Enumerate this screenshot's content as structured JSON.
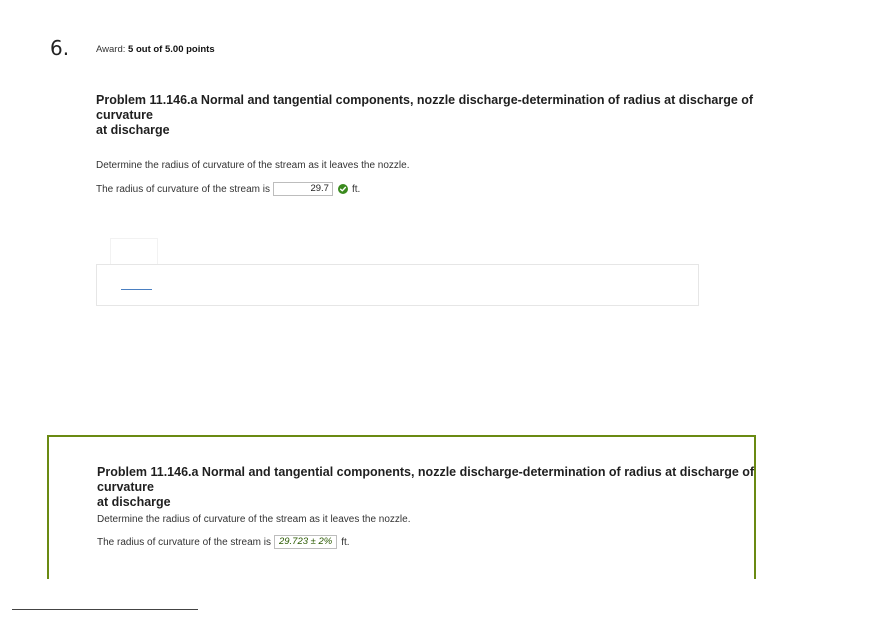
{
  "question": {
    "number": "6.",
    "award_label": "Award:",
    "award_value": "5 out of 5.00 points"
  },
  "problem": {
    "title_line1": "Problem 11.146.a Normal and tangential components, nozzle discharge-determination of radius at discharge of curvature",
    "title_line2": "at discharge",
    "prompt": "Determine the radius of curvature of the stream as it leaves the nozzle.",
    "answer_label": "The radius of curvature of the stream is",
    "answer_value": "29.7",
    "answer_unit": "ft."
  },
  "solution": {
    "title_line1": "Problem 11.146.a Normal and tangential components, nozzle discharge-determination of radius at discharge of curvature",
    "title_line2": "at discharge",
    "prompt": "Determine the radius of curvature of the stream as it leaves the nozzle.",
    "answer_label": "The radius of curvature of the stream is",
    "answer_value": "29.723 ± 2%",
    "answer_unit": "ft."
  },
  "colors": {
    "correct_green": "#3a8a1e",
    "solution_border": "#6a8a12",
    "link_blue": "#4a7fc1"
  },
  "icons": {
    "correct": "check-circle-icon"
  }
}
